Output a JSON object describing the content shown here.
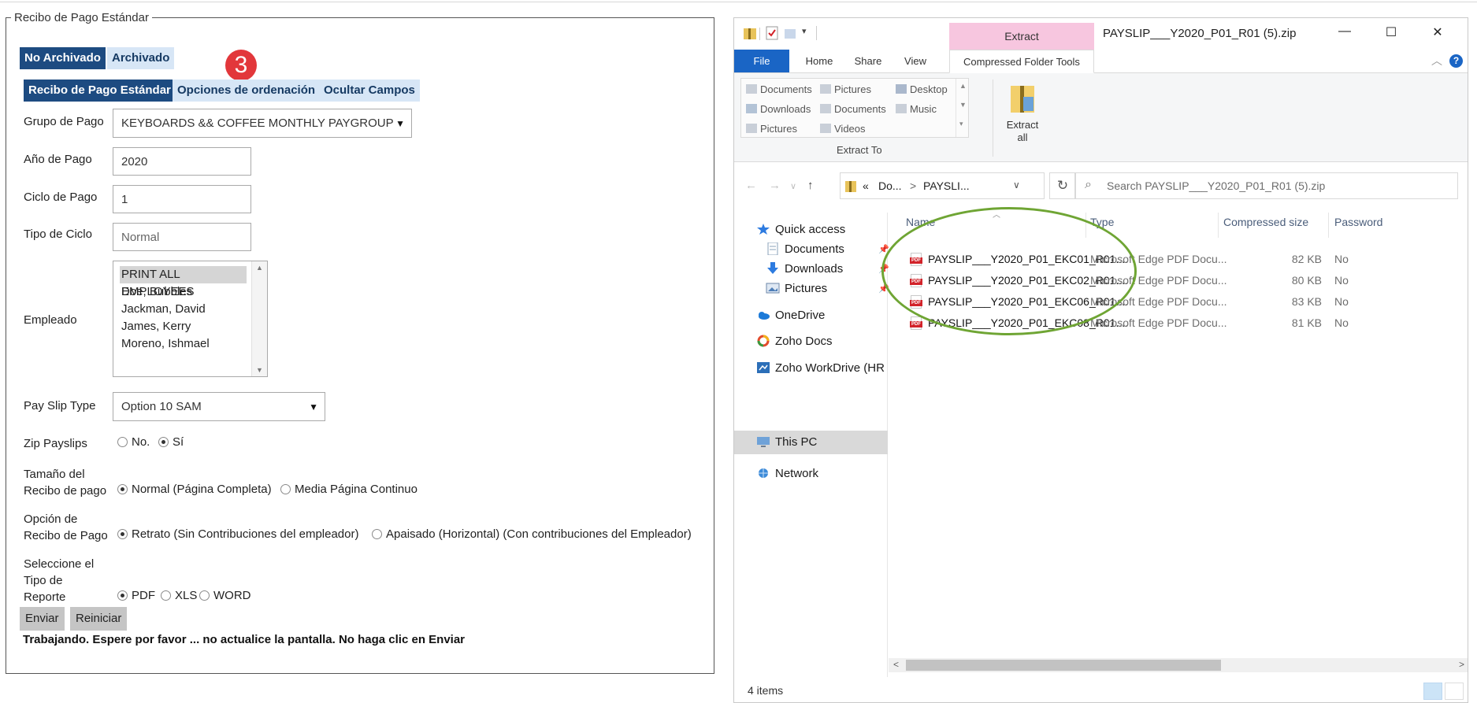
{
  "form": {
    "legend": "Recibo de Pago Estándar",
    "archive_tabs": [
      "No Archivado",
      "Archivado"
    ],
    "step_badge": "3",
    "section_tabs": [
      "Recibo de Pago Estándar",
      "Opciones de ordenación",
      "Ocultar Campos"
    ],
    "pay_group": {
      "label": "Grupo de Pago",
      "value": "KEYBOARDS && COFFEE MONTHLY PAYGROUP"
    },
    "pay_year": {
      "label": "Año de Pago",
      "value": "2020"
    },
    "pay_cycle": {
      "label": "Ciclo de Pago",
      "value": "1"
    },
    "cycle_type": {
      "label": "Tipo de Ciclo",
      "placeholder": "Normal"
    },
    "employee": {
      "label": "Empleado",
      "options": [
        "PRINT ALL EMPLOYEES",
        "Doe, Bubbles",
        "Jackman, David",
        "James, Kerry",
        "Moreno, Ishmael"
      ],
      "selected": "PRINT ALL EMPLOYEES"
    },
    "payslip_type": {
      "label": "Pay Slip Type",
      "value": "Option 10 SAM"
    },
    "zip_payslips": {
      "label": "Zip Payslips",
      "options": [
        "No.",
        "Sí"
      ],
      "selected": "Sí"
    },
    "payslip_size": {
      "label_line1": "Tamaño del",
      "label_line2": "Recibo de pago",
      "options": [
        "Normal (Página Completa)",
        "Media Página Continuo"
      ],
      "selected": "Normal (Página Completa)"
    },
    "payslip_option": {
      "label_line1": "Opción de",
      "label_line2": "Recibo de Pago",
      "options": [
        "Retrato (Sin Contribuciones del empleador)",
        "Apaisado (Horizontal) (Con contribuciones del Empleador)"
      ],
      "selected": "Retrato (Sin Contribuciones del empleador)"
    },
    "report_type": {
      "label_line1": "Seleccione el",
      "label_line2": "Tipo de",
      "label_line3": "Reporte",
      "options": [
        "PDF",
        "XLS",
        "WORD"
      ],
      "selected": "PDF"
    },
    "submit_label": "Enviar",
    "reset_label": "Reiniciar",
    "status_message": "Trabajando. Espere por favor ... no actualice la pantalla. No haga clic en Enviar"
  },
  "explorer": {
    "title": "PAYSLIP___Y2020_P01_R01 (5).zip",
    "context_tab": "Extract",
    "ribbon_tabs": [
      "File",
      "Home",
      "Share",
      "View",
      "Compressed Folder Tools"
    ],
    "gallery": [
      "Documents",
      "Pictures",
      "Desktop",
      "Downloads",
      "Documents",
      "Music",
      "Pictures",
      "Videos"
    ],
    "extract_to_label": "Extract To",
    "extract_all_line1": "Extract",
    "extract_all_line2": "all",
    "address": {
      "chevrons": "«",
      "crumb1": "Do...",
      "sep": ">",
      "crumb2": "PAYSLI..."
    },
    "search_placeholder": "Search PAYSLIP___Y2020_P01_R01 (5).zip",
    "nav": {
      "quick_access": "Quick access",
      "qa_items": [
        "Documents",
        "Downloads",
        "Pictures"
      ],
      "onedrive": "OneDrive",
      "zoho_docs": "Zoho Docs",
      "zoho_workdrive": "Zoho WorkDrive (HR",
      "this_pc": "This PC",
      "network": "Network"
    },
    "columns": [
      "Name",
      "Type",
      "Compressed size",
      "Password"
    ],
    "files": [
      {
        "name": "PAYSLIP___Y2020_P01_EKC01_R01....",
        "type": "Microsoft Edge PDF Docu...",
        "size": "82 KB",
        "password": "No"
      },
      {
        "name": "PAYSLIP___Y2020_P01_EKC02_R01....",
        "type": "Microsoft Edge PDF Docu...",
        "size": "80 KB",
        "password": "No"
      },
      {
        "name": "PAYSLIP___Y2020_P01_EKC06_R01....",
        "type": "Microsoft Edge PDF Docu...",
        "size": "83 KB",
        "password": "No"
      },
      {
        "name": "PAYSLIP___Y2020_P01_EKC08_R01....",
        "type": "Microsoft Edge PDF Docu...",
        "size": "81 KB",
        "password": "No"
      }
    ],
    "item_count": "4 items"
  },
  "colors": {
    "tab_active": "#1d4b81",
    "tab_inactive": "#d7e6f6",
    "badge": "#e2373b",
    "file_tab": "#1a65c5",
    "extract_context": "#f7c6df",
    "highlight_ellipse": "#6fa534"
  },
  "icons": [
    "zip-folder-icon",
    "pdf-file-icon",
    "star-icon",
    "cloud-icon",
    "pc-icon",
    "network-icon",
    "search-icon",
    "refresh-icon",
    "pin-icon"
  ]
}
